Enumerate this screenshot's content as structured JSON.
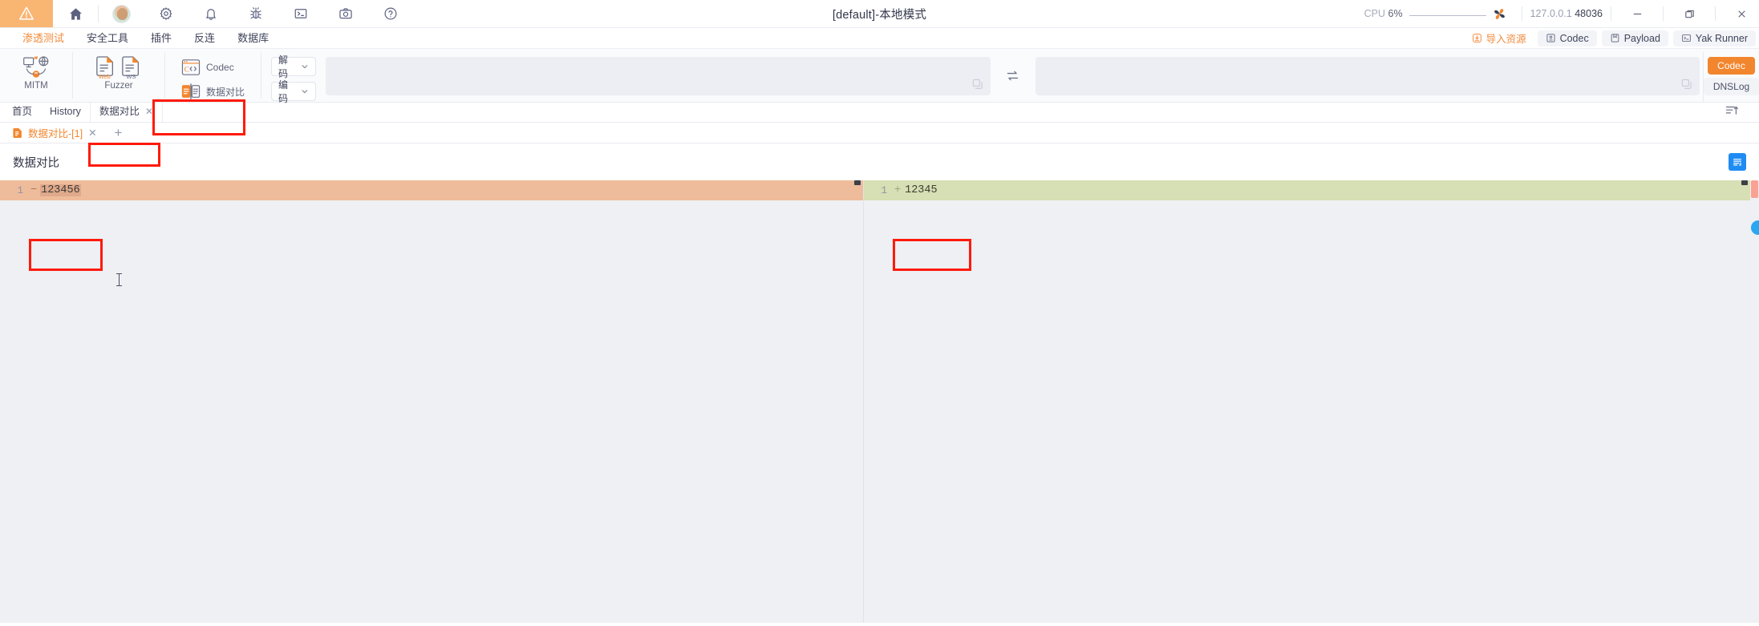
{
  "titlebar": {
    "title": "[default]-本地模式",
    "cpu_label": "CPU",
    "cpu_value": "6%",
    "address_host": "127.0.0.1",
    "address_port": "48036",
    "icons": [
      "warning-triangle-logo",
      "home-icon",
      "user-avatar",
      "gear-icon",
      "bell-icon",
      "bug-icon",
      "terminal-icon",
      "camera-icon",
      "help-icon"
    ],
    "window_controls": [
      "minimize",
      "restore",
      "close"
    ]
  },
  "menubar": {
    "items": [
      {
        "label": "渗透测试",
        "active": true
      },
      {
        "label": "安全工具",
        "active": false
      },
      {
        "label": "插件",
        "active": false
      },
      {
        "label": "反连",
        "active": false
      },
      {
        "label": "数据库",
        "active": false
      }
    ],
    "right": {
      "import_label": "导入资源",
      "buttons": [
        "Codec",
        "Payload",
        "Yak Runner"
      ]
    }
  },
  "ribbon": {
    "tools": [
      {
        "label": "MITM",
        "icon": "mitm-icon"
      },
      {
        "label": "Fuzzer",
        "icon": "fuzzer-icon",
        "badges": [
          "Web",
          "WS"
        ]
      }
    ],
    "rows": [
      {
        "label": "Codec",
        "icon": "codec-icon",
        "highlighted": false
      },
      {
        "label": "数据对比",
        "icon": "data-compare-icon",
        "highlighted": true
      }
    ],
    "selects": [
      {
        "label": "解码"
      },
      {
        "label": "编码"
      }
    ],
    "swap_icon": "swap-arrows-icon",
    "copy_icon": "copy-icon"
  },
  "rightrail": {
    "buttons": [
      {
        "label": "Codec",
        "active": true
      },
      {
        "label": "DNSLog",
        "active": false
      }
    ],
    "sort_icon": "sort-ascending-icon"
  },
  "tabs": {
    "items": [
      {
        "label": "首页",
        "active": false,
        "closable": false
      },
      {
        "label": "History",
        "active": false,
        "closable": false
      },
      {
        "label": "数据对比",
        "active": true,
        "closable": true,
        "highlighted": true
      }
    ],
    "close_glyph": "✕"
  },
  "subtabs": {
    "items": [
      {
        "label": "数据对比-[1]",
        "icon": "file-icon",
        "active": true
      }
    ],
    "add_glyph": "+",
    "close_glyph": "✕"
  },
  "diff": {
    "title": "数据对比",
    "action_icon": "format-lines-icon",
    "left": {
      "line_number": "1",
      "marker": "−",
      "text": "123456",
      "highlighted": true
    },
    "right": {
      "line_number": "1",
      "marker": "+",
      "text": "12345",
      "highlighted": true
    }
  },
  "colors": {
    "accent_orange": "#f2862e",
    "logo_bg": "#f9b572",
    "annotation_red": "#ff1a09",
    "diff_removed": "#efbc9b",
    "diff_added": "#d7dfb4",
    "action_blue": "#1f8cf3"
  }
}
